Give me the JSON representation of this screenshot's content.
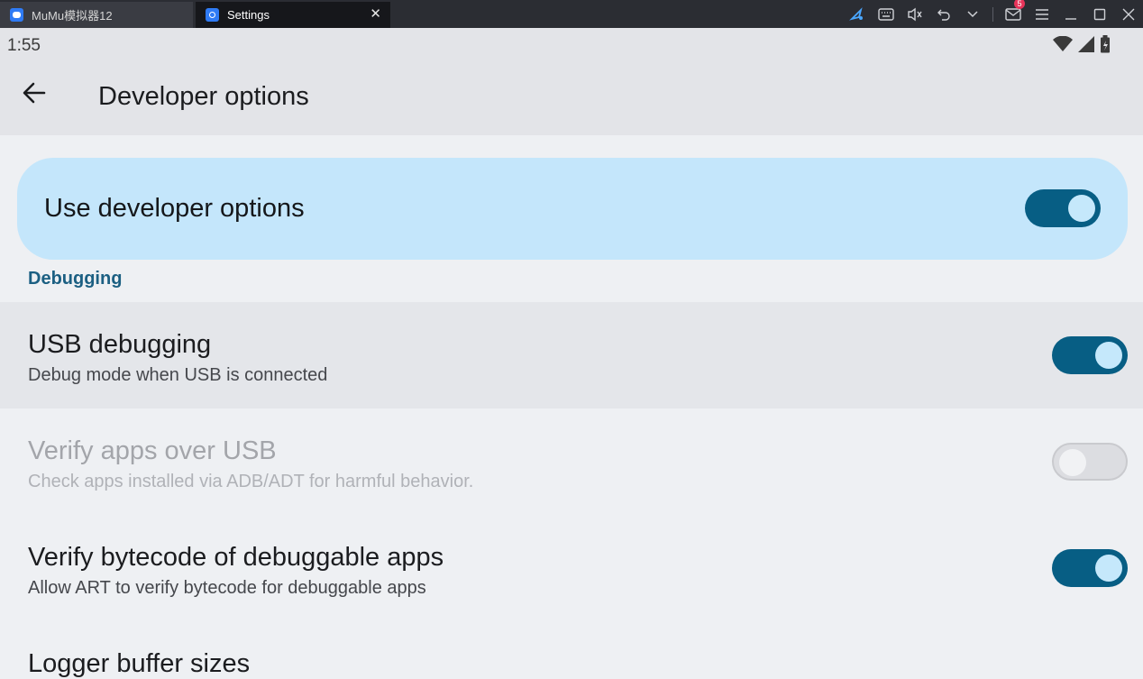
{
  "emulator": {
    "tabs": [
      {
        "label": "MuMu模拟器12",
        "icon": "mumu-app-icon"
      },
      {
        "label": "Settings",
        "icon": "settings-app-icon"
      }
    ],
    "notification_count": "5",
    "toolbar_icons": [
      "pointer-icon",
      "keyboard-icon",
      "mute-icon",
      "undo-icon",
      "chevron-down-icon",
      "mail-icon",
      "menu-icon",
      "minimize-icon",
      "maximize-icon",
      "close-icon"
    ]
  },
  "status_bar": {
    "time": "1:55",
    "icons": [
      "wifi-icon",
      "signal-icon",
      "battery-icon"
    ]
  },
  "app_bar": {
    "title": "Developer options"
  },
  "master_toggle": {
    "label": "Use developer options",
    "on": true
  },
  "section": {
    "title": "Debugging"
  },
  "settings": [
    {
      "title": "USB debugging",
      "subtitle": "Debug mode when USB is connected",
      "on": true,
      "enabled": true
    },
    {
      "title": "Verify apps over USB",
      "subtitle": "Check apps installed via ADB/ADT for harmful behavior.",
      "on": false,
      "enabled": false
    },
    {
      "title": "Verify bytecode of debuggable apps",
      "subtitle": "Allow ART to verify bytecode for debuggable apps",
      "on": true,
      "enabled": true
    },
    {
      "title": "Logger buffer sizes",
      "subtitle": ""
    }
  ],
  "colors": {
    "accent": "#075e84",
    "card": "#c4e6fb",
    "section": "#1b5f82"
  }
}
